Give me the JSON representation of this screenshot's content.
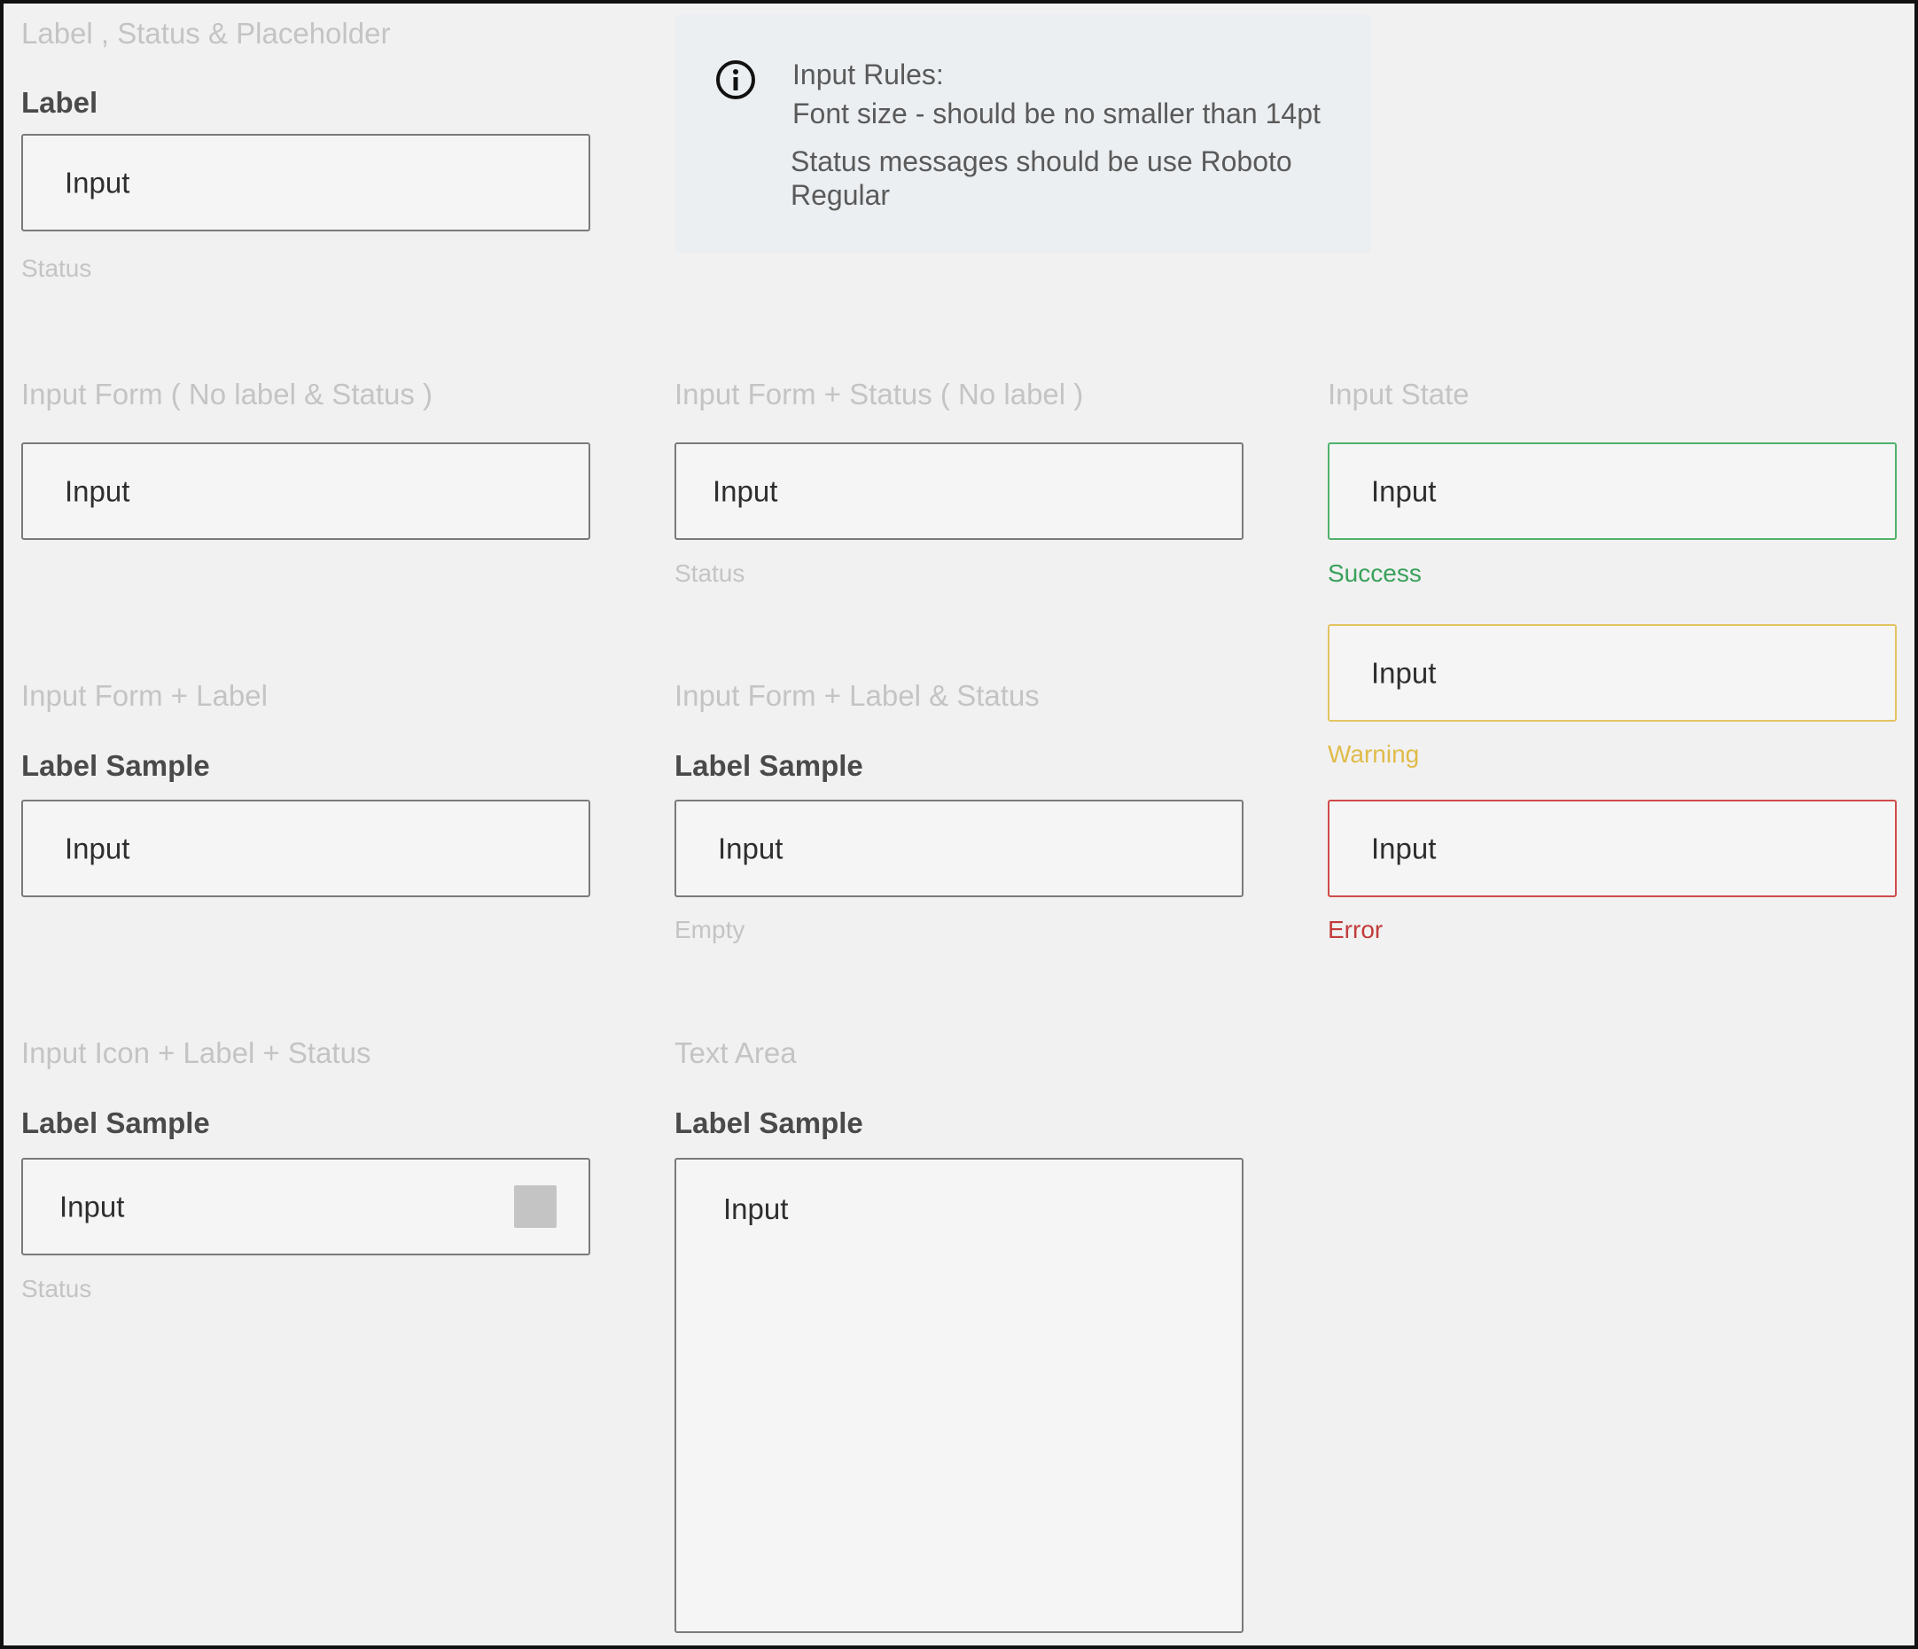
{
  "sections": {
    "basic": {
      "title": "Label , Status & Placeholder",
      "label": "Label",
      "input_value": "Input",
      "status": "Status"
    },
    "info": {
      "icon": "info-icon",
      "title": "Input Rules:",
      "rule_1": "Font size - should be no smaller than 14pt",
      "rule_2": "Status messages should be use Roboto Regular"
    },
    "no_label_no_status": {
      "title": "Input Form ( No label & Status )",
      "input_value": "Input"
    },
    "status_no_label": {
      "title": "Input Form + Status ( No label )",
      "input_value": "Input",
      "status": "Status"
    },
    "input_state": {
      "title": "Input State",
      "success": {
        "input_value": "Input",
        "status": "Success",
        "color": "#3aa15c"
      },
      "warning": {
        "input_value": "Input",
        "status": "Warning",
        "color": "#e0bb49"
      },
      "error": {
        "input_value": "Input",
        "status": "Error",
        "color": "#c33b3b"
      }
    },
    "with_label": {
      "title": "Input Form + Label",
      "label": "Label Sample",
      "input_value": "Input"
    },
    "label_and_status": {
      "title": "Input Form + Label & Status",
      "label": "Label Sample",
      "input_value": "Input",
      "status": "Empty"
    },
    "icon_label_status": {
      "title": "Input Icon + Label + Status",
      "label": "Label Sample",
      "input_value": "Input",
      "trailing_icon": "square-placeholder-icon",
      "status": "Status"
    },
    "text_area": {
      "title": "Text Area",
      "label": "Label Sample",
      "input_value": "Input"
    }
  }
}
